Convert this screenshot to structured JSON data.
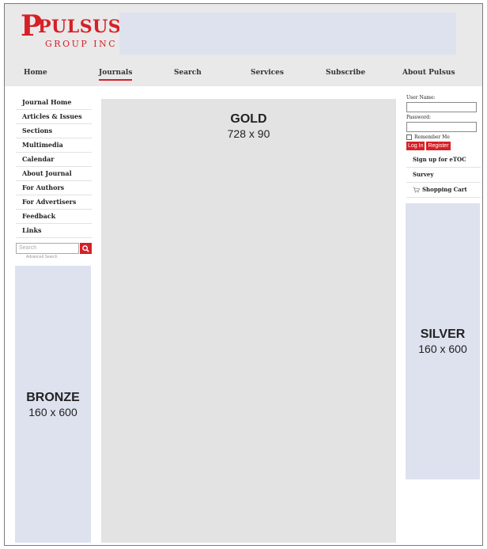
{
  "brand": {
    "logo_main": "PULSUS",
    "logo_sub": "GROUP INC"
  },
  "nav": [
    {
      "label": "Home"
    },
    {
      "label": "Journals"
    },
    {
      "label": "Search"
    },
    {
      "label": "Services"
    },
    {
      "label": "Subscribe"
    },
    {
      "label": "About Pulsus"
    }
  ],
  "active_nav": "Journals",
  "sidebar": {
    "items": [
      {
        "label": "Journal Home"
      },
      {
        "label": "Articles & Issues"
      },
      {
        "label": "Sections"
      },
      {
        "label": "Multimedia"
      },
      {
        "label": "Calendar"
      },
      {
        "label": "About Journal"
      },
      {
        "label": "For Authors"
      },
      {
        "label": "For Advertisers"
      },
      {
        "label": "Feedback"
      },
      {
        "label": "Links"
      }
    ],
    "search_placeholder": "Search",
    "advanced_search": "Advanced Search"
  },
  "ads": {
    "bronze": {
      "name": "BRONZE",
      "size": "160 x 600"
    },
    "gold": {
      "name": "GOLD",
      "size": "728 x 90"
    },
    "silver": {
      "name": "SILVER",
      "size": "160 x 600"
    }
  },
  "login": {
    "username_label": "User Name:",
    "password_label": "Password:",
    "remember_label": "Remember Me",
    "login_button": "Log In",
    "register_button": "Register"
  },
  "right_links": [
    {
      "label": "Sign up for eTOC"
    },
    {
      "label": "Survey"
    },
    {
      "label": "Shopping Cart"
    }
  ],
  "colors": {
    "accent": "#d62027",
    "ad_blue": "#dee2ef",
    "ad_gray": "#e3e3e3"
  },
  "icons": {
    "search": "search-icon",
    "cart": "shopping-cart-icon"
  }
}
